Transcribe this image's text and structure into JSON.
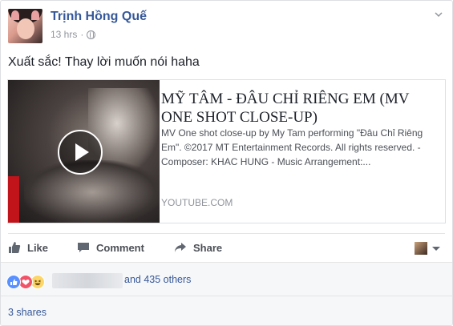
{
  "post": {
    "author": "Trịnh Hồng Quế",
    "time": "13 hrs",
    "time_separator": "·",
    "text": "Xuất sắc! Thay lời muốn nói haha"
  },
  "link": {
    "title": "MỸ TÂM - ĐÂU CHỈ RIÊNG EM (MV ONE SHOT CLOSE-UP)",
    "description": "MV One shot close-up by My Tam performing \"Đâu Chỉ Riêng Em\". ©2017 MT Entertainment Records. All rights reserved. - Composer: KHAC HUNG - Music Arrangement:...",
    "domain": "YOUTUBE.COM"
  },
  "actions": {
    "like_label": "Like",
    "comment_label": "Comment",
    "share_label": "Share"
  },
  "reactions": {
    "others_text": "and 435 others",
    "icons": [
      "like-icon",
      "love-icon",
      "haha-icon"
    ],
    "colors": {
      "like": "#5890ff",
      "love": "#f25268",
      "haha": "#fcd669"
    }
  },
  "shares": {
    "label": "3 shares"
  },
  "colors": {
    "link": "#365899",
    "meta": "#90949c",
    "text": "#1d2129"
  }
}
